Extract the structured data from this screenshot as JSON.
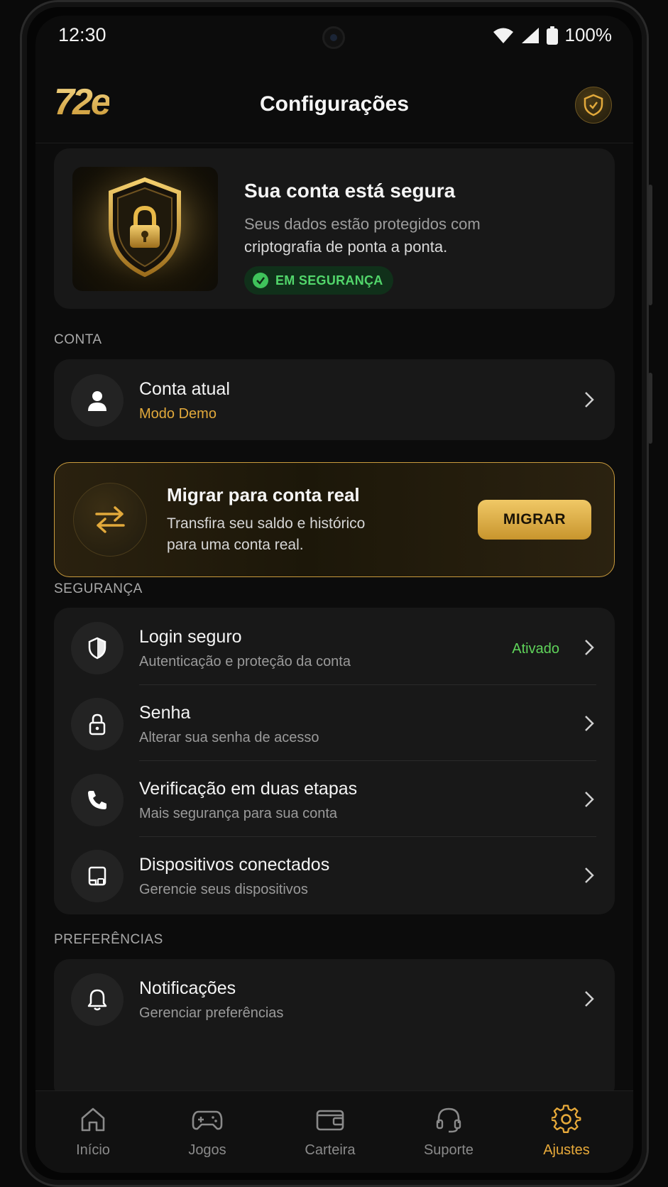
{
  "status_bar": {
    "time": "12:30",
    "battery": "100%"
  },
  "header": {
    "logo": "72e",
    "title": "Configurações"
  },
  "hero": {
    "title": "Sua conta está segura",
    "desc_line1": "Seus dados estão protegidos com",
    "desc_line2": "criptografia de ponta a ponta.",
    "badge": "EM SEGURANÇA"
  },
  "sections": {
    "conta": "CONTA",
    "seguranca": "SEGURANÇA",
    "preferencias": "PREFERÊNCIAS"
  },
  "account": {
    "title": "Conta atual",
    "subtitle": "Modo Demo"
  },
  "migrate": {
    "title": "Migrar para conta real",
    "desc_line1": "Transfira seu saldo e histórico",
    "desc_line2": "para uma conta real.",
    "button": "MIGRAR"
  },
  "security_items": [
    {
      "title": "Login seguro",
      "subtitle": "Autenticação e proteção da conta",
      "status": "Ativado",
      "icon": "shield-icon"
    },
    {
      "title": "Senha",
      "subtitle": "Alterar sua senha de acesso",
      "icon": "lock-icon"
    },
    {
      "title": "Verificação em duas etapas",
      "subtitle": "Mais segurança para sua conta",
      "icon": "phone-icon"
    },
    {
      "title": "Dispositivos conectados",
      "subtitle": "Gerencie seus dispositivos",
      "icon": "device-icon"
    }
  ],
  "preferences": [
    {
      "title": "Notificações",
      "subtitle": "Gerenciar preferências",
      "icon": "bell-icon"
    }
  ],
  "nav": [
    {
      "label": "Início",
      "icon": "home-icon"
    },
    {
      "label": "Jogos",
      "icon": "gamepad-icon"
    },
    {
      "label": "Carteira",
      "icon": "wallet-icon"
    },
    {
      "label": "Suporte",
      "icon": "headset-icon"
    },
    {
      "label": "Ajustes",
      "icon": "gear-icon",
      "active": true
    }
  ],
  "colors": {
    "accent": "#e8aa3a",
    "success": "#52d66b",
    "background": "#0c0c0c",
    "card": "#181818"
  }
}
